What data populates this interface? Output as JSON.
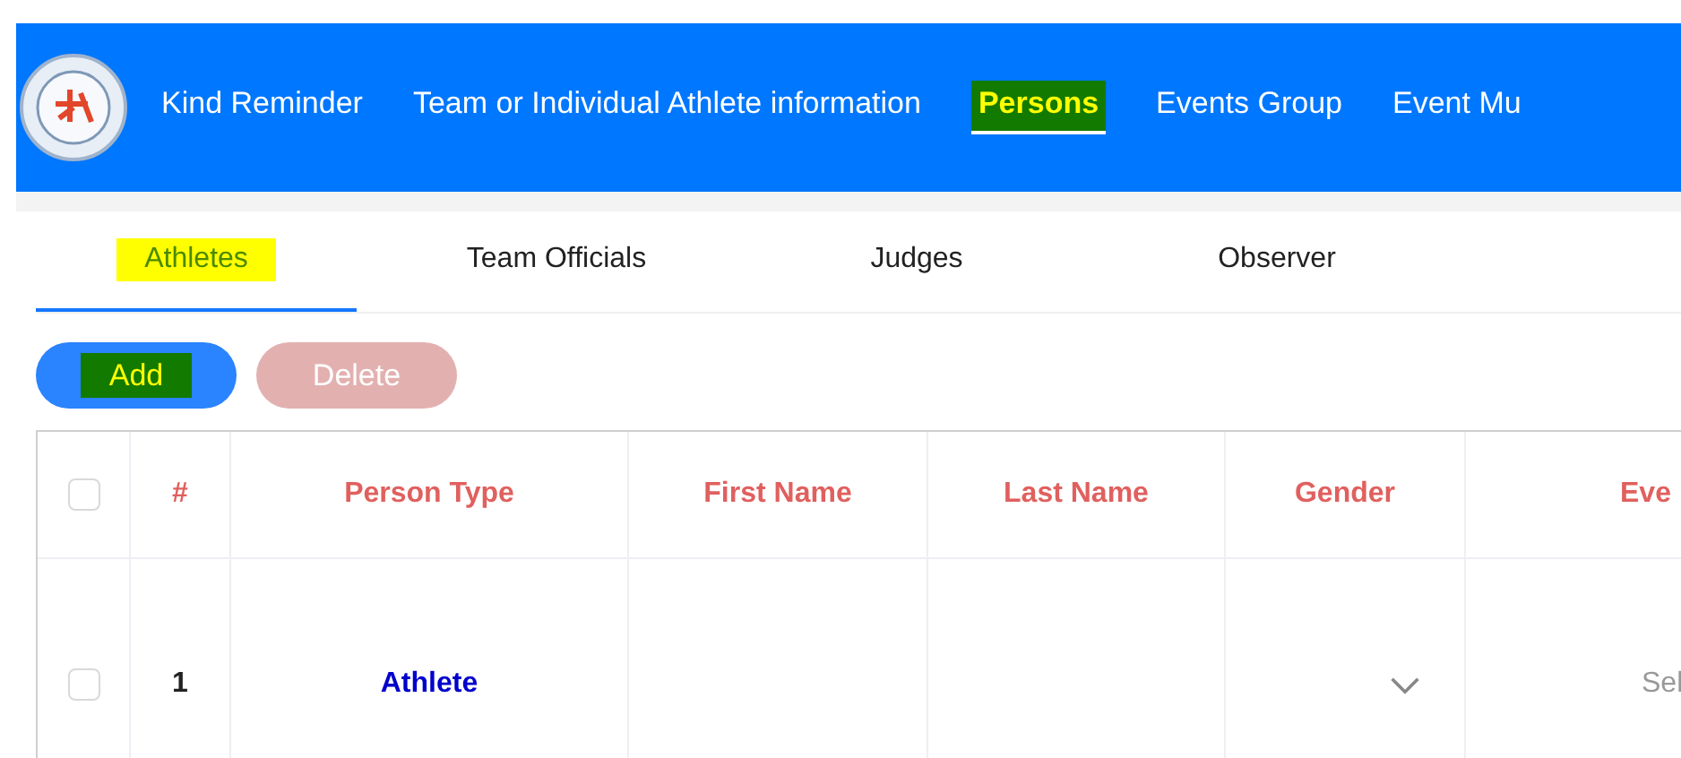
{
  "nav": [
    {
      "label": "Kind Reminder",
      "selected": false,
      "highlighted": false
    },
    {
      "label": "Team or Individual Athlete information",
      "selected": false,
      "highlighted": false
    },
    {
      "label": "Persons",
      "selected": true,
      "highlighted": true
    },
    {
      "label": "Events Group",
      "selected": false,
      "highlighted": false
    },
    {
      "label": "Event Mu",
      "selected": false,
      "highlighted": false
    }
  ],
  "tabs": [
    {
      "label": "Athletes",
      "selected": true,
      "highlighted": true
    },
    {
      "label": "Team Officials",
      "selected": false,
      "highlighted": false
    },
    {
      "label": "Judges",
      "selected": false,
      "highlighted": false
    },
    {
      "label": "Observer",
      "selected": false,
      "highlighted": false
    }
  ],
  "buttons": [
    {
      "label": "Add",
      "disabled": false,
      "highlighted": true
    },
    {
      "label": "Delete",
      "disabled": true,
      "highlighted": false
    }
  ],
  "table": {
    "header_checked": false,
    "columns": [
      "#",
      "Person Type",
      "First Name",
      "Last Name",
      "Gender",
      "Eve"
    ],
    "rows": [
      {
        "checked": false,
        "number": "1",
        "person_type": "Athlete",
        "first_name": "",
        "last_name": "",
        "gender_placeholder": "",
        "event_placeholder": "Sel"
      }
    ]
  }
}
